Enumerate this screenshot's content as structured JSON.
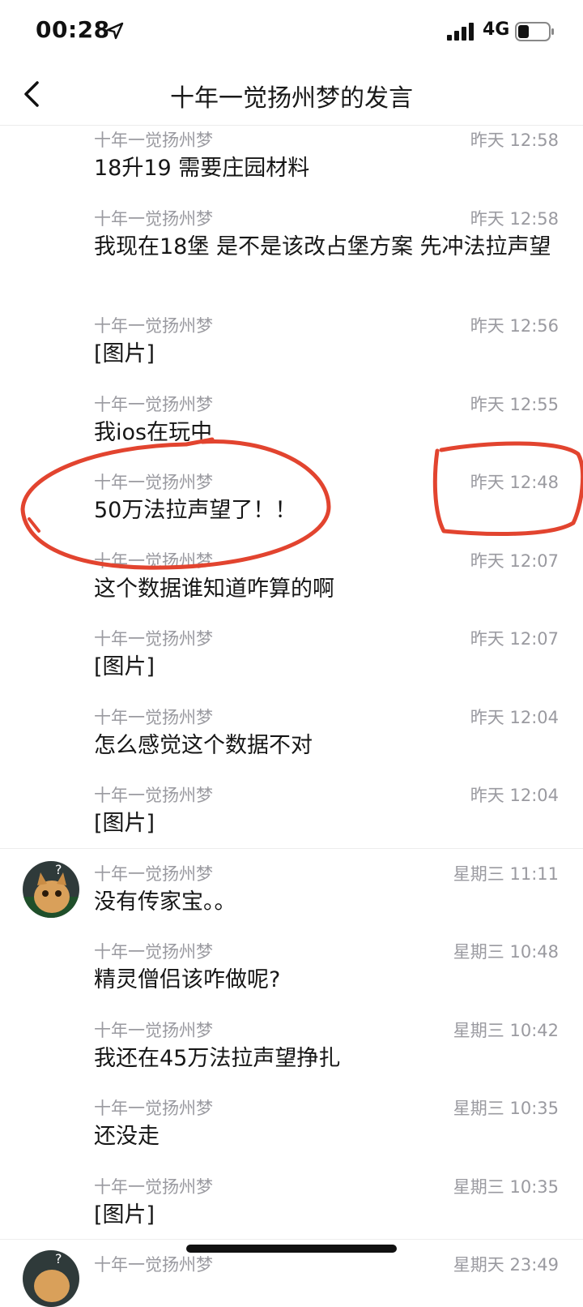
{
  "status_bar": {
    "time": "00:28",
    "network": "4G",
    "icons": [
      "location-arrow-icon",
      "signal-icon",
      "battery-icon"
    ]
  },
  "nav": {
    "title": "十年一觉扬州梦的发言",
    "back_icon": "chevron-left-icon"
  },
  "messages": [
    {
      "author": "十年一觉扬州梦",
      "time": "昨天 12:58",
      "text": "18升19 需要庄园材料"
    },
    {
      "author": "十年一觉扬州梦",
      "time": "昨天 12:58",
      "text": "我现在18堡  是不是该改占堡方案 先冲法拉声望"
    },
    {
      "author": "十年一觉扬州梦",
      "time": "昨天 12:56",
      "text": "[图片]"
    },
    {
      "author": "十年一觉扬州梦",
      "time": "昨天 12:55",
      "text": "我ios在玩中"
    },
    {
      "author": "十年一觉扬州梦",
      "time": "昨天 12:48",
      "text": "50万法拉声望了！！"
    },
    {
      "author": "十年一觉扬州梦",
      "time": "昨天 12:07",
      "text": "这个数据谁知道咋算的啊"
    },
    {
      "author": "十年一觉扬州梦",
      "time": "昨天 12:07",
      "text": "[图片]"
    },
    {
      "author": "十年一觉扬州梦",
      "time": "昨天 12:04",
      "text": "怎么感觉这个数据不对"
    },
    {
      "author": "十年一觉扬州梦",
      "time": "昨天 12:04",
      "text": "[图片]"
    },
    {
      "author": "十年一觉扬州梦",
      "time": "星期三 11:11",
      "text": "没有传家宝。。"
    },
    {
      "author": "十年一觉扬州梦",
      "time": "星期三 10:48",
      "text": "精灵僧侣该咋做呢?"
    },
    {
      "author": "十年一觉扬州梦",
      "time": "星期三 10:42",
      "text": "我还在45万法拉声望挣扎"
    },
    {
      "author": "十年一觉扬州梦",
      "time": "星期三 10:35",
      "text": "还没走"
    },
    {
      "author": "十年一觉扬州梦",
      "time": "星期三 10:35",
      "text": "[图片]"
    },
    {
      "author": "十年一觉扬州梦",
      "time": "星期天 23:49",
      "text": ""
    }
  ],
  "colors": {
    "annotation": "#e2442f",
    "meta_text": "#9a9aa0",
    "body_text": "#161616"
  }
}
